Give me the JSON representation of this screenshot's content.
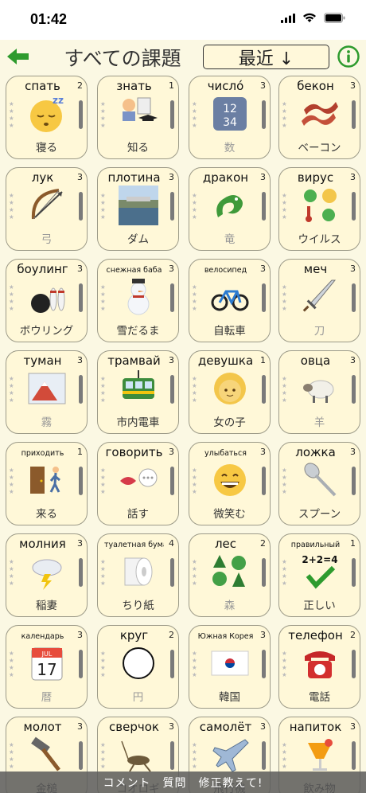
{
  "status": {
    "time": "01:42"
  },
  "nav": {
    "title": "すべての課題",
    "sort_label": "最近 ↓"
  },
  "cards": [
    {
      "word": "спать",
      "count": "2",
      "reading": "寝る",
      "faded": false,
      "small": false,
      "emoji": "sleeping-face"
    },
    {
      "word": "знать",
      "count": "1",
      "reading": "知る",
      "faded": false,
      "small": false,
      "emoji": "teacher-books"
    },
    {
      "word": "число́",
      "count": "3",
      "reading": "数",
      "faded": true,
      "small": false,
      "emoji": "numbers-1234"
    },
    {
      "word": "бекон",
      "count": "3",
      "reading": "ベーコン",
      "faded": false,
      "small": false,
      "emoji": "bacon"
    },
    {
      "word": "лук",
      "count": "3",
      "reading": "弓",
      "faded": true,
      "small": false,
      "emoji": "bow-arrow"
    },
    {
      "word": "плотина",
      "count": "3",
      "reading": "ダム",
      "faded": false,
      "small": false,
      "emoji": "dam-photo"
    },
    {
      "word": "дракон",
      "count": "3",
      "reading": "竜",
      "faded": true,
      "small": false,
      "emoji": "dragon"
    },
    {
      "word": "вирус",
      "count": "3",
      "reading": "ウイルス",
      "faded": false,
      "small": false,
      "emoji": "virus"
    },
    {
      "word": "боулинг",
      "count": "3",
      "reading": "ボウリング",
      "faded": false,
      "small": false,
      "emoji": "bowling"
    },
    {
      "word": "снежная баба",
      "count": "3",
      "reading": "雪だるま",
      "faded": false,
      "small": true,
      "emoji": "snowman"
    },
    {
      "word": "велосипед",
      "count": "3",
      "reading": "自転車",
      "faded": false,
      "small": true,
      "emoji": "bicycle"
    },
    {
      "word": "меч",
      "count": "3",
      "reading": "刀",
      "faded": true,
      "small": false,
      "emoji": "sword"
    },
    {
      "word": "туман",
      "count": "3",
      "reading": "霧",
      "faded": true,
      "small": false,
      "emoji": "foggy-mountain"
    },
    {
      "word": "трамвай",
      "count": "3",
      "reading": "市内電車",
      "faded": false,
      "small": false,
      "emoji": "tram"
    },
    {
      "word": "девушка",
      "count": "1",
      "reading": "女の子",
      "faded": false,
      "small": false,
      "emoji": "girl"
    },
    {
      "word": "овца",
      "count": "3",
      "reading": "羊",
      "faded": true,
      "small": false,
      "emoji": "sheep"
    },
    {
      "word": "приходить",
      "count": "1",
      "reading": "来る",
      "faded": false,
      "small": true,
      "emoji": "door-walking"
    },
    {
      "word": "говорить",
      "count": "3",
      "reading": "話す",
      "faded": false,
      "small": false,
      "emoji": "lips-speech"
    },
    {
      "word": "улыбаться",
      "count": "3",
      "reading": "微笑む",
      "faded": false,
      "small": true,
      "emoji": "smiling-face"
    },
    {
      "word": "ложка",
      "count": "3",
      "reading": "スプーン",
      "faded": false,
      "small": false,
      "emoji": "spoon"
    },
    {
      "word": "молния",
      "count": "3",
      "reading": "稲妻",
      "faded": false,
      "small": false,
      "emoji": "lightning-cloud"
    },
    {
      "word": "туалетная бумага",
      "count": "4",
      "reading": "ちり紙",
      "faded": false,
      "small": true,
      "emoji": "toilet-paper"
    },
    {
      "word": "лес",
      "count": "2",
      "reading": "森",
      "faded": true,
      "small": false,
      "emoji": "forest"
    },
    {
      "word": "правильный",
      "count": "1",
      "reading": "正しい",
      "faded": false,
      "small": true,
      "emoji": "check-math"
    },
    {
      "word": "календарь",
      "count": "3",
      "reading": "暦",
      "faded": true,
      "small": true,
      "emoji": "calendar"
    },
    {
      "word": "круг",
      "count": "2",
      "reading": "円",
      "faded": true,
      "small": false,
      "emoji": "circle"
    },
    {
      "word": "Южная Корея",
      "count": "3",
      "reading": "韓国",
      "faded": false,
      "small": true,
      "emoji": "korea-flag"
    },
    {
      "word": "телефон",
      "count": "2",
      "reading": "電話",
      "faded": false,
      "small": false,
      "emoji": "telephone"
    },
    {
      "word": "молот",
      "count": "3",
      "reading": "金槌",
      "faded": false,
      "small": false,
      "emoji": "hammer"
    },
    {
      "word": "сверчок",
      "count": "3",
      "reading": "コオロギ",
      "faded": false,
      "small": false,
      "emoji": "cricket"
    },
    {
      "word": "самолёт",
      "count": "3",
      "reading": "飛行機",
      "faded": false,
      "small": false,
      "emoji": "airplane"
    },
    {
      "word": "напиток",
      "count": "3",
      "reading": "飲み物",
      "faded": false,
      "small": false,
      "emoji": "cocktail"
    }
  ],
  "toast": {
    "message": "コメント　質問　修正教えて!"
  },
  "colors": {
    "accent_green": "#2e9b2e",
    "card_bg": "#fff8d8",
    "page_bg": "#fbf8e3"
  }
}
